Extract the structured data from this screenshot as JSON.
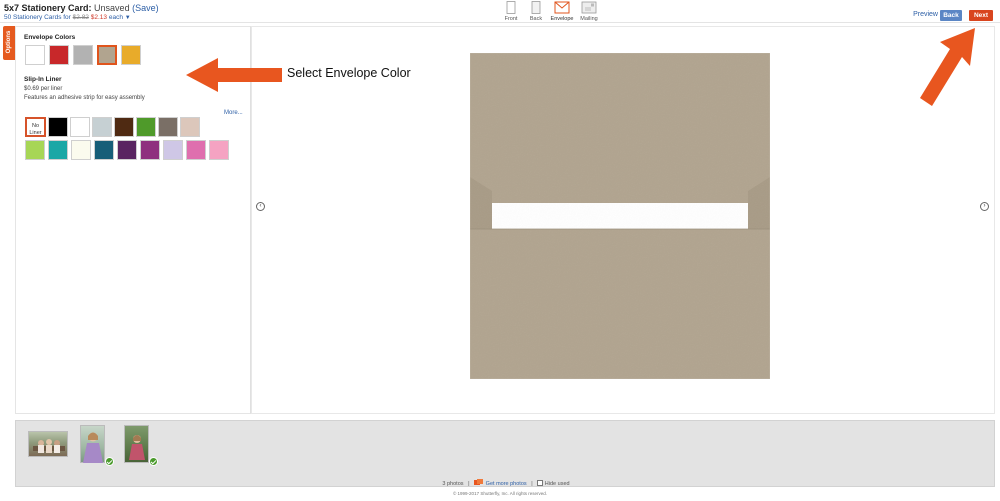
{
  "header": {
    "title": "5x7 Stationery Card:",
    "status": "Unsaved",
    "save_label": "(Save)",
    "subtitle_prefix": "50 Stationery Cards for",
    "old_price": "$2.82",
    "new_price": "$2.13",
    "price_suffix": "each",
    "caret": "▼"
  },
  "view_tabs": [
    {
      "label": "Front"
    },
    {
      "label": "Back"
    },
    {
      "label": "Envelope",
      "active": true
    },
    {
      "label": "Mailing"
    }
  ],
  "actions": {
    "preview_label": "Preview",
    "back_label": "Back",
    "next_label": "Next"
  },
  "options": {
    "tab_label": "Options",
    "envelope_title": "Envelope Colors",
    "envelope_colors": [
      "#ffffff",
      "#c8282a",
      "#b2b2b2",
      "#b1a48f",
      "#e8ab2a"
    ],
    "selected_envelope": "#b1a48f",
    "liner_title": "Slip-In Liner",
    "liner_price": "$0.69 per liner",
    "liner_desc": "Features an adhesive strip for easy assembly",
    "more_label": "More...",
    "no_liner_label_1": "No",
    "no_liner_label_2": "Liner",
    "liner_colors_row1": [
      "#000000",
      "#ffffff",
      "#c6d0d3",
      "#4f2a12",
      "#4f9a2a",
      "#7a6f66",
      "#dcc7bb"
    ],
    "liner_colors_row2": [
      "#a7d656",
      "#1aa7a6",
      "#fbfbee",
      "#175e78",
      "#5a2561",
      "#8f2f7e",
      "#cfc7e6",
      "#df6fae",
      "#f5a3c2"
    ]
  },
  "callout": {
    "text": "Select Envelope Color"
  },
  "canvas": {
    "envelope_color": "#b1a48f",
    "prev_arrow": "‹",
    "next_arrow": "›"
  },
  "filmstrip": {
    "photo_count": "3 photos",
    "get_more_label": "Get more photos",
    "hide_used_label": "Hide used",
    "separator": "|"
  },
  "footer": {
    "copyright": "© 1999-2017 Shutterfly, Inc. All rights reserved."
  }
}
